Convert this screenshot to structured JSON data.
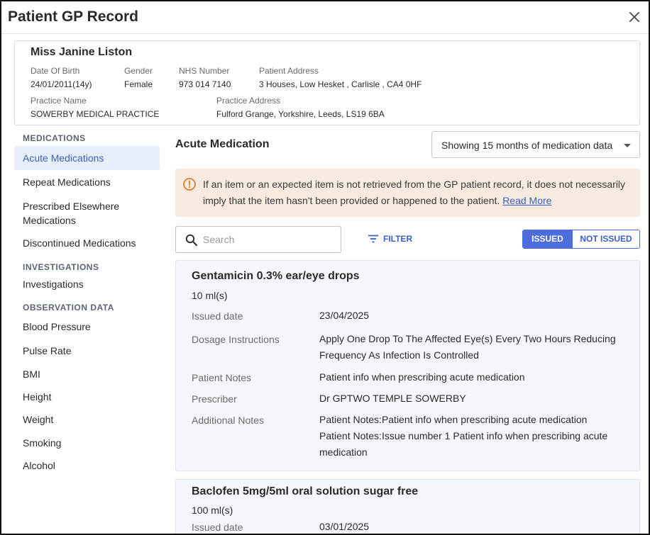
{
  "window": {
    "title": "Patient GP Record"
  },
  "patient": {
    "name": "Miss Janine Liston",
    "dob_label": "Date Of Birth",
    "dob": "24/01/2011(14y)",
    "gender_label": "Gender",
    "gender": "Female",
    "nhs_label": "NHS Number",
    "nhs": "973 014 7140",
    "address_label": "Patient Address",
    "address": "3 Houses, Low Hesket , Carlisle , CA4 0HF",
    "practice_label": "Practice Name",
    "practice": "SOWERBY MEDICAL PRACTICE",
    "practice_address_label": "Practice Address",
    "practice_address": "Fulford Grange, Yorkshire, Leeds, LS19 6BA"
  },
  "sidebar": {
    "medications_header": "MEDICATIONS",
    "medications": [
      "Acute Medications",
      "Repeat Medications",
      "Prescribed Elsewhere Medications",
      "Discontinued Medications"
    ],
    "investigations_header": "INVESTIGATIONS",
    "investigations": [
      "Investigations"
    ],
    "observation_header": "OBSERVATION DATA",
    "observations": [
      "Blood Pressure",
      "Pulse Rate",
      "BMI",
      "Height",
      "Weight",
      "Smoking",
      "Alcohol"
    ]
  },
  "main": {
    "title": "Acute Medication",
    "range_select": "Showing 15 months of medication data",
    "alert_text": "If an item or an expected item is not retrieved from the GP patient record, it does not necessarily imply that the item hasn't been provided or happened to the patient.",
    "alert_link": "Read More",
    "search_placeholder": "Search",
    "filter_label": "FILTER",
    "toggle_issued": "ISSUED",
    "toggle_not_issued": "NOT ISSUED",
    "field_labels": {
      "issued": "Issued date",
      "dosage": "Dosage Instructions",
      "notes": "Patient Notes",
      "prescriber": "Prescriber",
      "additional": "Additional Notes"
    },
    "medications": [
      {
        "name": "Gentamicin 0.3% ear/eye drops",
        "quantity": "10 ml(s)",
        "issued": "23/04/2025",
        "dosage": "Apply One Drop To The Affected Eye(s) Every Two Hours Reducing Frequency As Infection Is Controlled",
        "notes": "Patient info when prescribing acute medication",
        "prescriber": "Dr GPTWO TEMPLE SOWERBY",
        "additional_1": "Patient Notes:Patient info when prescribing acute medication",
        "additional_2": "Patient Notes:Issue number 1 Patient info when prescribing acute medication"
      },
      {
        "name": "Baclofen 5mg/5ml oral solution sugar free",
        "quantity": "100 ml(s)",
        "issued": "03/01/2025"
      }
    ]
  },
  "colors": {
    "accent": "#3c5fc9",
    "toggle_active": "#4c6ddb",
    "alert_bg": "#f7ebe0",
    "alert_icon": "#e07b2a",
    "nav_active_bg": "#e8eefb",
    "card_bg": "#f4f7fb"
  }
}
